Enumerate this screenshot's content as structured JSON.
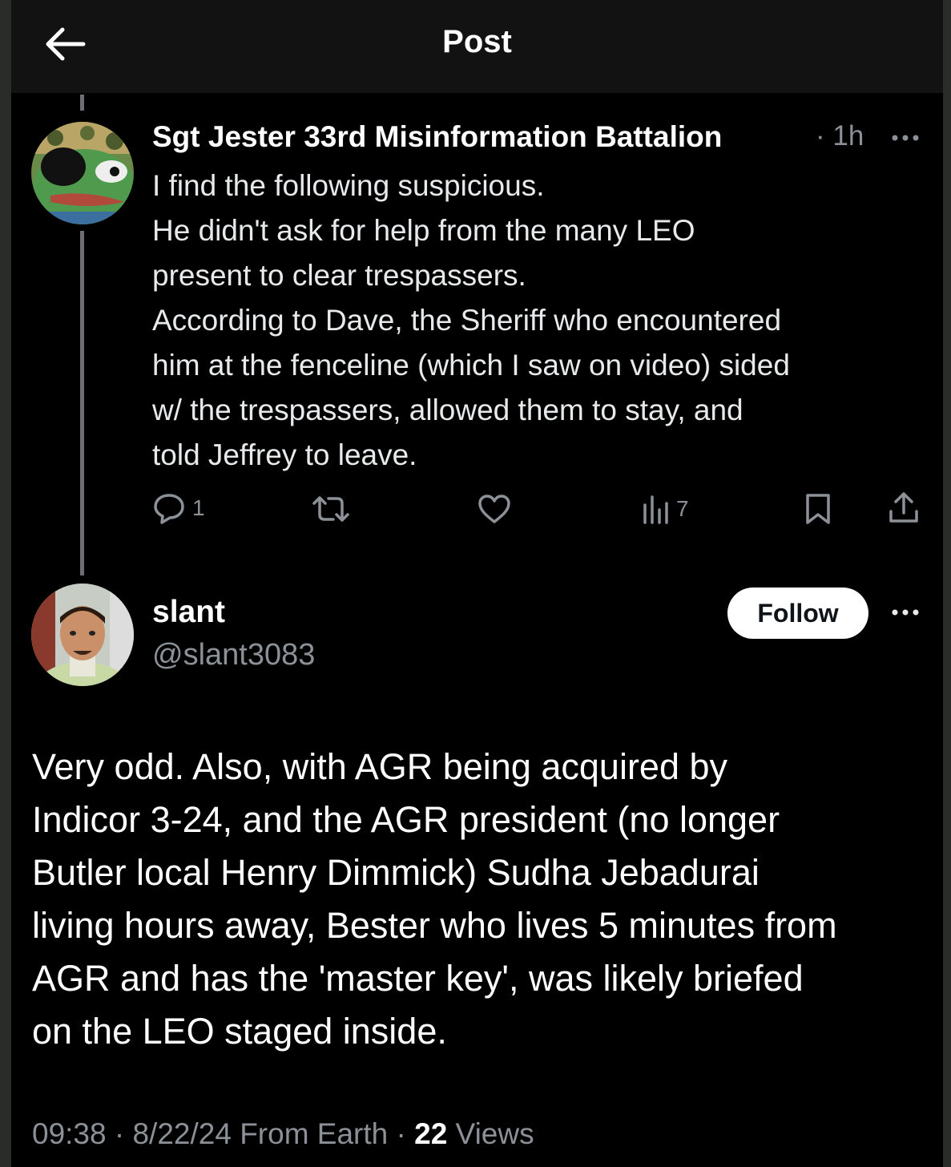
{
  "header": {
    "title": "Post"
  },
  "post1": {
    "author": "Sgt Jester 33rd Misinformation Battalion",
    "age": "· 1h",
    "lines": [
      "I find the following suspicious.",
      "He didn't ask for help from the many LEO",
      "present to clear trespassers.",
      "According to Dave, the Sheriff who encountered",
      "him at the fenceline (which I saw on video) sided",
      "w/ the trespassers, allowed them to stay, and",
      "told Jeffrey to leave."
    ],
    "reply_count": "1",
    "view_count": "7"
  },
  "post2": {
    "name": "slant",
    "handle": "@slant3083",
    "follow_label": "Follow",
    "lines": [
      "Very odd. Also, with AGR being acquired by",
      "Indicor 3-24, and the AGR president (no longer",
      "Butler local Henry Dimmick) Sudha Jebadurai",
      "living hours away, Bester who lives 5 minutes from",
      "AGR and has the 'master key', was likely briefed",
      "on the LEO staged inside."
    ],
    "footer_prefix": "09:38 · 8/22/24 From Earth · ",
    "views_count": "22",
    "views_label": " Views"
  },
  "colors": {
    "background": "#000000",
    "muted": "#8b9197",
    "thread_line": "#6b6f74"
  },
  "icons": [
    "arrow-left-icon",
    "more-icon",
    "reply-icon",
    "repost-icon",
    "like-icon",
    "views-icon",
    "bookmark-icon",
    "share-icon"
  ]
}
